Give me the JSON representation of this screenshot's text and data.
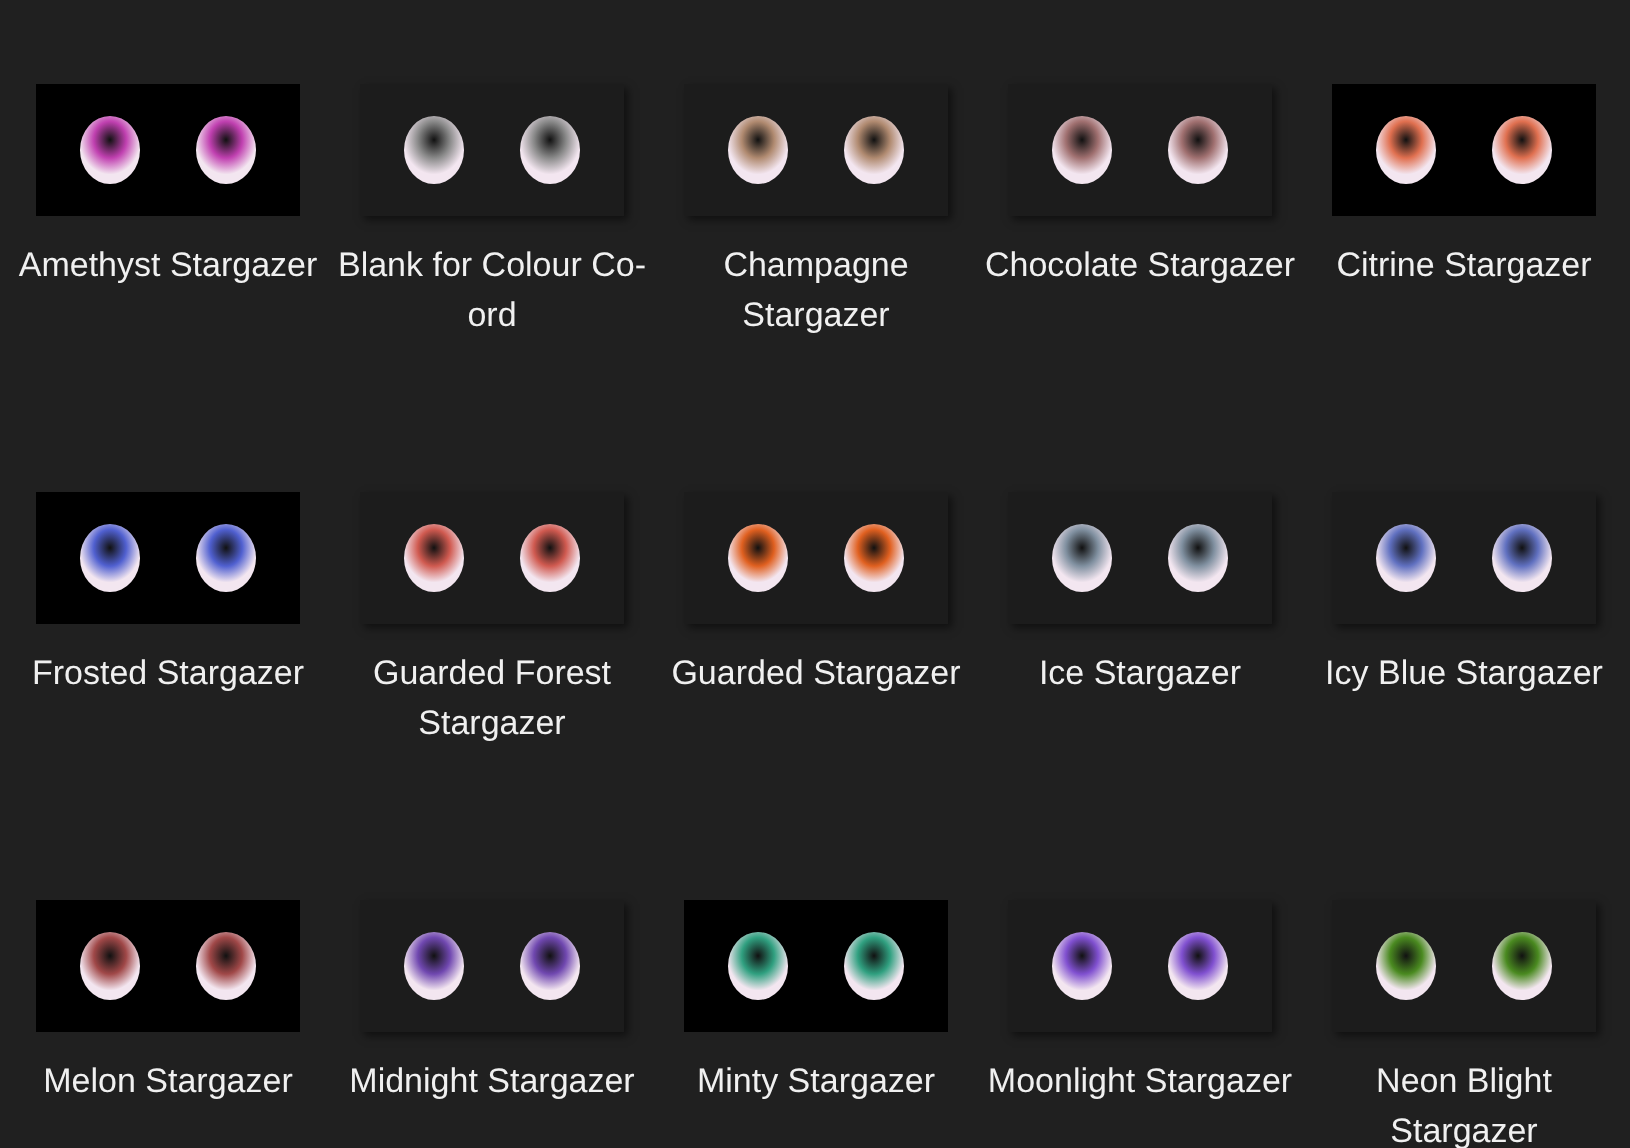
{
  "items": [
    {
      "name": "Amethyst Stargazer",
      "kind": "black",
      "color": "#c040b0"
    },
    {
      "name": "Blank for Colour Co-ord",
      "kind": "dark",
      "color": "#8a8a8a"
    },
    {
      "name": "Champagne Stargazer",
      "kind": "dark",
      "color": "#b08a70"
    },
    {
      "name": "Chocolate Stargazer",
      "kind": "dark",
      "color": "#a07070"
    },
    {
      "name": "Citrine Stargazer",
      "kind": "black",
      "color": "#e07050"
    },
    {
      "name": "Frosted Stargazer",
      "kind": "black",
      "color": "#5060d0"
    },
    {
      "name": "Guarded Forest Stargazer",
      "kind": "dark",
      "color": "#d05a50"
    },
    {
      "name": "Guarded Stargazer",
      "kind": "dark",
      "color": "#e06020"
    },
    {
      "name": "Ice Stargazer",
      "kind": "dark",
      "color": "#8090a0"
    },
    {
      "name": "Icy Blue Stargazer",
      "kind": "dark",
      "color": "#6070c0"
    },
    {
      "name": "Melon Stargazer",
      "kind": "black",
      "color": "#a04848"
    },
    {
      "name": "Midnight Stargazer",
      "kind": "dark",
      "color": "#7048b0"
    },
    {
      "name": "Minty Stargazer",
      "kind": "black",
      "color": "#30a080"
    },
    {
      "name": "Moonlight Stargazer",
      "kind": "dark",
      "color": "#8050d0"
    },
    {
      "name": "Neon Blight Stargazer",
      "kind": "dark",
      "color": "#4a8a20"
    }
  ]
}
